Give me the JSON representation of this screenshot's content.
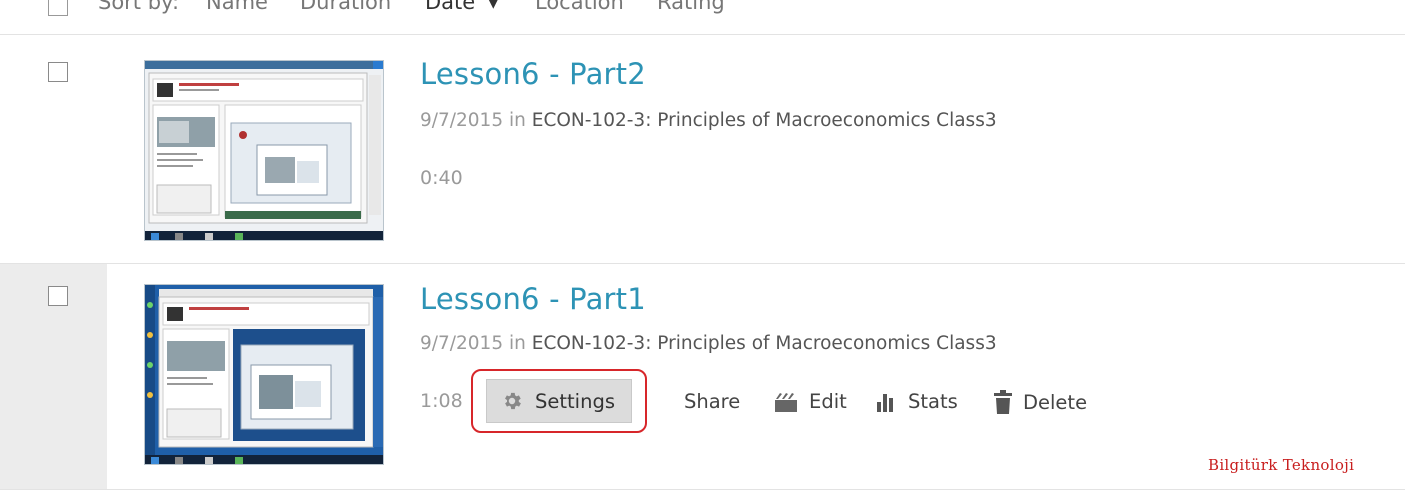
{
  "sort_bar": {
    "label": "Sort by:",
    "options": [
      "Name",
      "Duration",
      "Date",
      "Location",
      "Rating"
    ],
    "active_option": "Date",
    "active_indicator": "▾"
  },
  "videos": [
    {
      "title": "Lesson6 - Part2",
      "date": "9/7/2015",
      "in_text": "in",
      "course": "ECON-102-3: Principles of Macroeconomics Class3",
      "duration": "0:40"
    },
    {
      "title": "Lesson6 - Part1",
      "date": "9/7/2015",
      "in_text": "in",
      "course": "ECON-102-3: Principles of Macroeconomics Class3",
      "duration": "1:08",
      "actions": {
        "settings": "Settings",
        "share": "Share",
        "edit": "Edit",
        "stats": "Stats",
        "delete": "Delete"
      }
    }
  ],
  "watermark": "Bilgitürk Teknoloji",
  "colors": {
    "title_link": "#2d93b5",
    "highlight_outline": "#d7262a",
    "watermark": "#c81e1e",
    "selected_row_gutter": "#ececec"
  },
  "icons": {
    "settings": "gear-icon",
    "edit": "film-edit-icon",
    "stats": "bar-chart-icon",
    "delete": "trash-icon"
  }
}
